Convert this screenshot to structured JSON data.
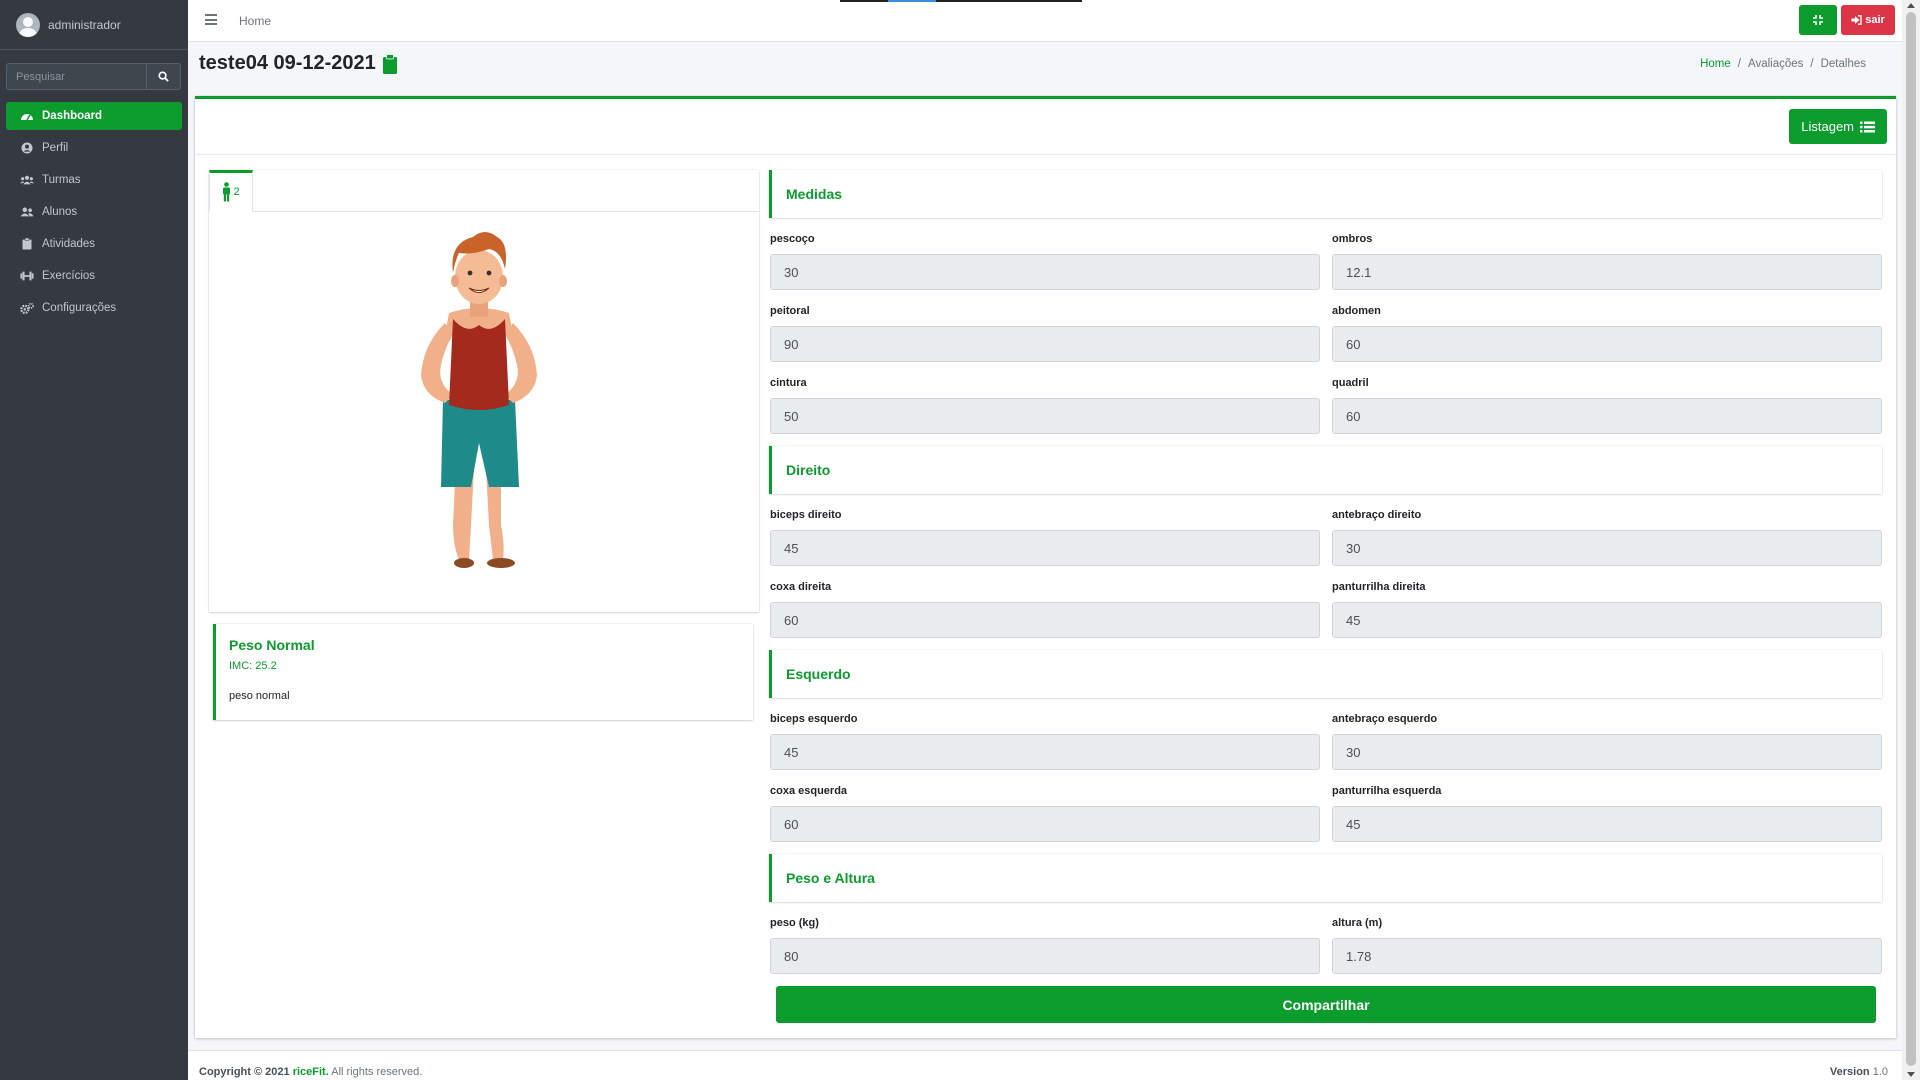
{
  "sidebar": {
    "user": "administrador",
    "search_placeholder": "Pesquisar",
    "items": [
      {
        "label": "Dashboard",
        "icon": "dashboard-icon",
        "active": true
      },
      {
        "label": "Perfil",
        "icon": "user-circle-icon"
      },
      {
        "label": "Turmas",
        "icon": "users-icon"
      },
      {
        "label": "Alunos",
        "icon": "user-friends-icon"
      },
      {
        "label": "Atividades",
        "icon": "clipboard-icon"
      },
      {
        "label": "Exercícios",
        "icon": "dumbbell-icon"
      },
      {
        "label": "Configurações",
        "icon": "cogs-icon"
      }
    ]
  },
  "topbar": {
    "home": "Home",
    "logout_label": "sair"
  },
  "header": {
    "title": "teste04 09-12-2021",
    "breadcrumb": [
      "Home",
      "Avaliações",
      "Detalhes"
    ]
  },
  "toolbar": {
    "listagem_label": "Listagem"
  },
  "figure_tab": {
    "count": "2"
  },
  "result": {
    "title": "Peso Normal",
    "imc": "IMC: 25.2",
    "description": "peso normal"
  },
  "sections": {
    "medidas": "Medidas",
    "direito": "Direito",
    "esquerdo": "Esquerdo",
    "peso_altura": "Peso e Altura"
  },
  "fields": {
    "pescoco": {
      "label": "pescoço",
      "value": "30"
    },
    "ombros": {
      "label": "ombros",
      "value": "12.1"
    },
    "peitoral": {
      "label": "peitoral",
      "value": "90"
    },
    "abdomen": {
      "label": "abdomen",
      "value": "60"
    },
    "cintura": {
      "label": "cintura",
      "value": "50"
    },
    "quadril": {
      "label": "quadril",
      "value": "60"
    },
    "biceps_direito": {
      "label": "biceps direito",
      "value": "45"
    },
    "antebraco_direito": {
      "label": "antebraço direito",
      "value": "30"
    },
    "coxa_direita": {
      "label": "coxa direita",
      "value": "60"
    },
    "panturrilha_direita": {
      "label": "panturrilha direita",
      "value": "45"
    },
    "biceps_esquerdo": {
      "label": "biceps esquerdo",
      "value": "45"
    },
    "antebraco_esquerdo": {
      "label": "antebraço esquerdo",
      "value": "30"
    },
    "coxa_esquerda": {
      "label": "coxa esquerda",
      "value": "60"
    },
    "panturrilha_esquerda": {
      "label": "panturrilha esquerda",
      "value": "45"
    },
    "peso": {
      "label": "peso (kg)",
      "value": "80"
    },
    "altura": {
      "label": "altura (m)",
      "value": "1.78"
    }
  },
  "share_label": "Compartilhar",
  "footer": {
    "copyright": "Copyright © 2021",
    "brand": "riceFit.",
    "rights": "All rights reserved.",
    "version_label": "Version",
    "version_value": "1.0"
  },
  "colors": {
    "accent": "#0c9c2e",
    "danger": "#dc3545",
    "sidebar_bg": "#343a40"
  }
}
